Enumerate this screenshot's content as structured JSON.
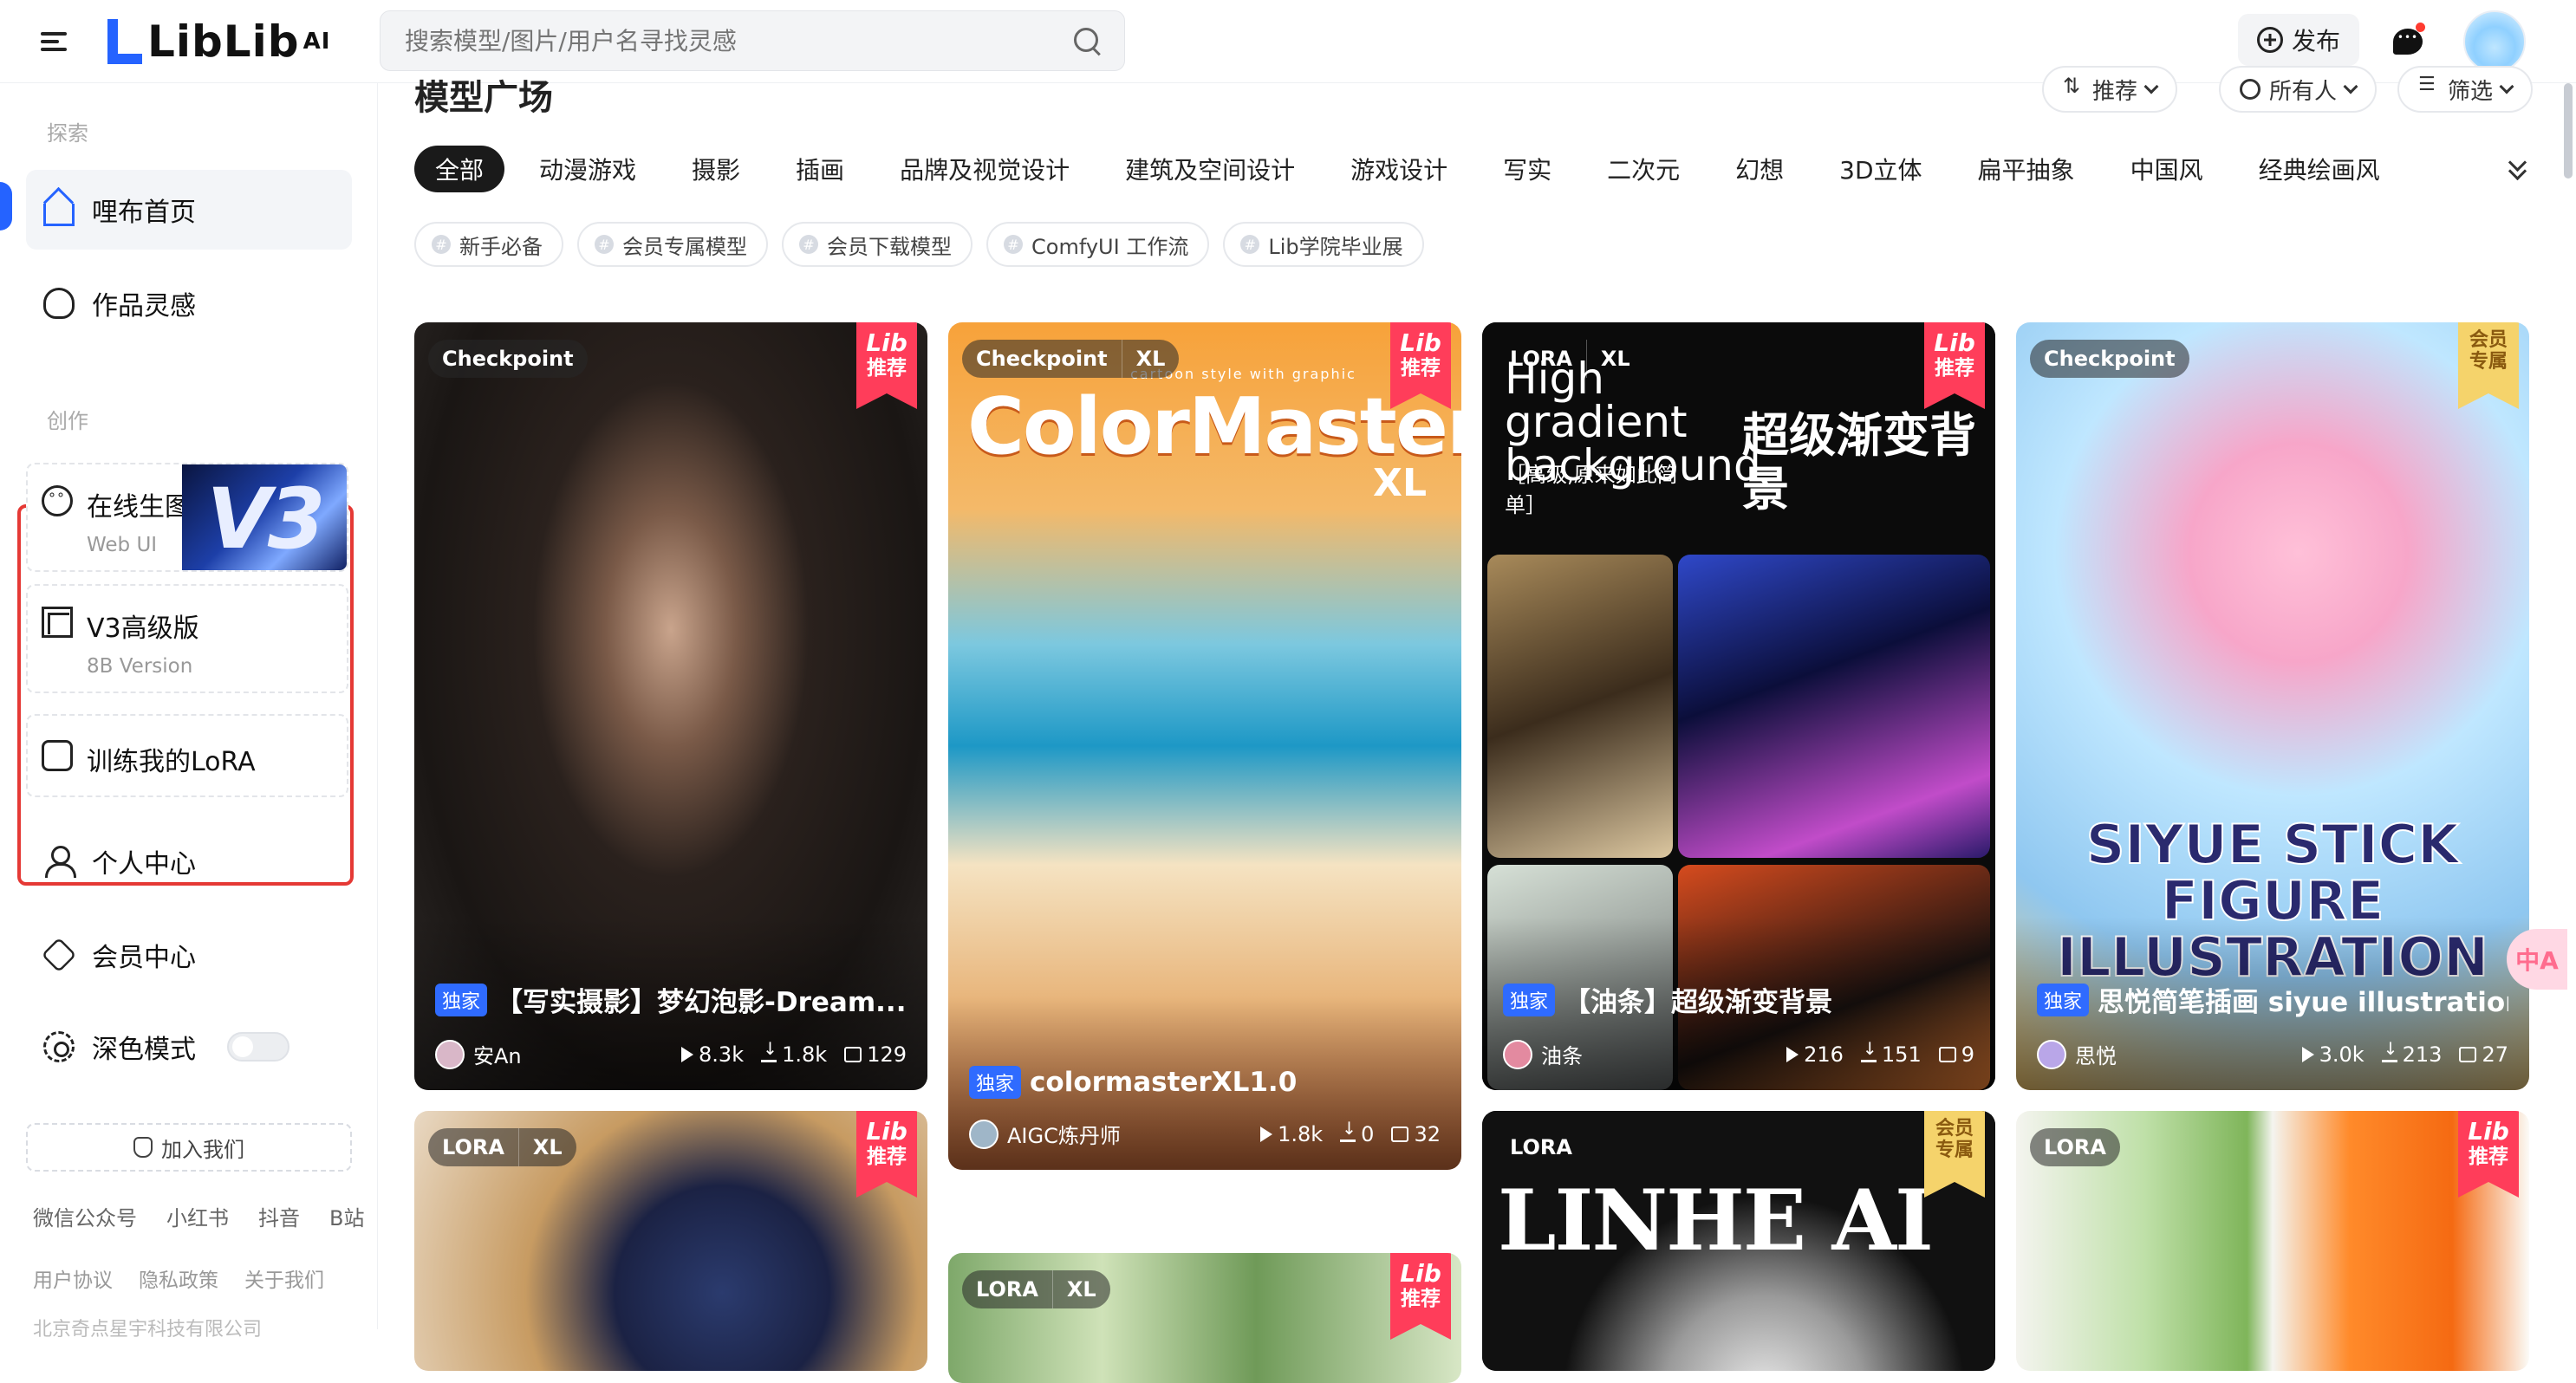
{
  "header": {
    "logo": "LibLib",
    "logo_sup": "AI",
    "search_placeholder": "搜索模型/图片/用户名寻找灵感",
    "publish_label": "发布"
  },
  "sidebar": {
    "explore_label": "探索",
    "explore_items": [
      {
        "label": "哩布首页"
      },
      {
        "label": "作品灵感"
      }
    ],
    "create_label": "创作",
    "create_items": [
      {
        "label": "在线生图",
        "sub": "Web UI",
        "badge": "V3"
      },
      {
        "label": "V3高级版",
        "sub": "8B Version"
      },
      {
        "label": "训练我的LoRA"
      }
    ],
    "other_items": [
      {
        "label": "个人中心"
      },
      {
        "label": "会员中心"
      },
      {
        "label": "深色模式"
      }
    ],
    "join_label": "加入我们",
    "social_links": [
      "微信公众号",
      "小红书",
      "抖音",
      "B站"
    ],
    "legal_links": [
      "用户协议",
      "隐私政策",
      "关于我们"
    ],
    "company": "北京奇点星宇科技有限公司"
  },
  "main": {
    "title": "模型广场",
    "sort_buttons": [
      "推荐",
      "所有人",
      "筛选"
    ],
    "categories": [
      "全部",
      "动漫游戏",
      "摄影",
      "插画",
      "品牌及视觉设计",
      "建筑及空间设计",
      "游戏设计",
      "写实",
      "二次元",
      "幻想",
      "3D立体",
      "扁平抽象",
      "中国风",
      "经典绘画风"
    ],
    "tags": [
      "新手必备",
      "会员专属模型",
      "会员下载模型",
      "ComfyUI 工作流",
      "Lib学院毕业展"
    ],
    "cards": [
      {
        "types": [
          "Checkpoint"
        ],
        "ribbon": [
          "Lib",
          "推荐"
        ],
        "exclusive": "独家",
        "title": "【写实摄影】梦幻泡影-Dream...",
        "author": "安An",
        "views": "8.3k",
        "downloads": "1.8k",
        "images": "129"
      },
      {
        "types": [
          "Checkpoint",
          "XL"
        ],
        "ribbon": [
          "Lib",
          "推荐"
        ],
        "overlay": "ColorMaster",
        "overlay_sub": "XL",
        "overlay_small": "cartoon style with graphic",
        "exclusive": "独家",
        "title": "colormasterXL1.0",
        "author": "AIGC炼丹师",
        "views": "1.8k",
        "downloads": "0",
        "images": "32"
      },
      {
        "types": [
          "LORA",
          "XL"
        ],
        "ribbon": [
          "Lib",
          "推荐"
        ],
        "overlay": "High gradient background",
        "overlay_cn": "超级渐变背景",
        "overlay_cn2": "［高级,原来如此简单］",
        "exclusive": "独家",
        "title": "【油条】超级渐变背景",
        "author": "油条",
        "views": "216",
        "downloads": "151",
        "images": "9"
      },
      {
        "types": [
          "Checkpoint"
        ],
        "ribbon": [
          "会员",
          "专属"
        ],
        "overlay": "SIYUE STICK FIGURE ILLUSTRATION",
        "exclusive": "独家",
        "title": "思悦简笔插画 siyue illustration",
        "author": "思悦",
        "views": "3.0k",
        "downloads": "213",
        "images": "27"
      },
      {
        "types": [
          "LORA",
          "XL"
        ],
        "ribbon": [
          "Lib",
          "推荐"
        ]
      },
      {
        "types": [
          "LORA",
          "XL"
        ],
        "ribbon": [
          "Lib",
          "推荐"
        ]
      },
      {
        "types": [
          "LORA"
        ],
        "ribbon": [
          "会员",
          "专属"
        ],
        "overlay": "LINHE AI"
      },
      {
        "types": [
          "LORA"
        ],
        "ribbon": [
          "Lib",
          "推荐"
        ]
      }
    ]
  },
  "float_label": "中A"
}
